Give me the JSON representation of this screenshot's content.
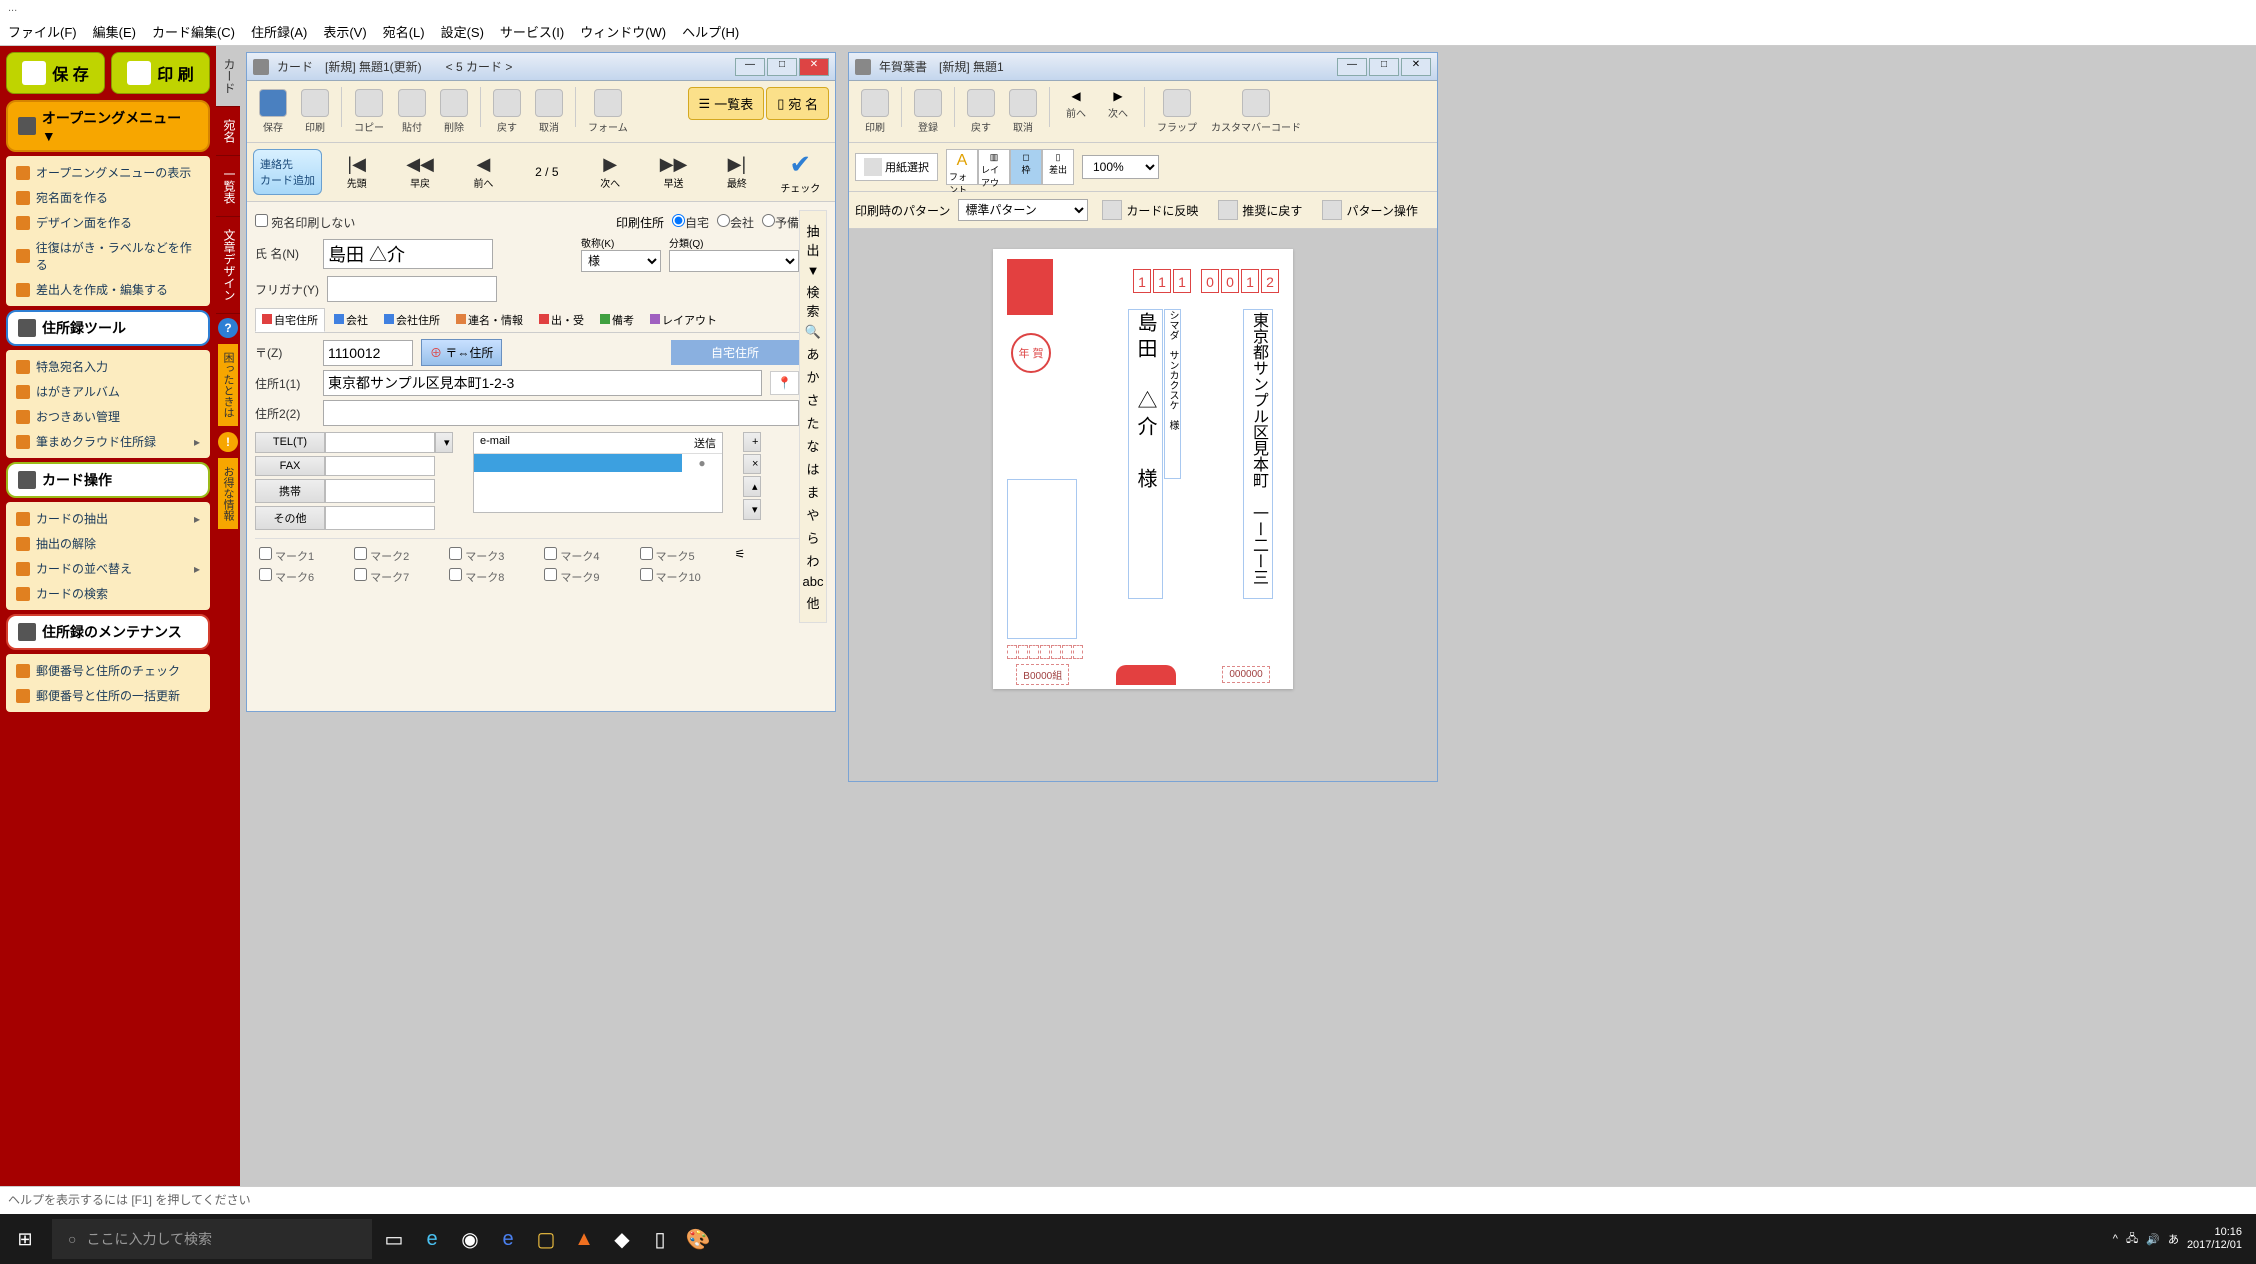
{
  "app_title": "...",
  "menubar": [
    "ファイル(F)",
    "編集(E)",
    "カード編集(C)",
    "住所録(A)",
    "表示(V)",
    "宛名(L)",
    "設定(S)",
    "サービス(I)",
    "ウィンドウ(W)",
    "ヘルプ(H)"
  ],
  "leftbar": {
    "save": "保 存",
    "print": "印 刷",
    "opening_hdr": "オープニングメニュー ▼",
    "opening_items": [
      "オープニングメニューの表示",
      "宛名面を作る",
      "デザイン面を作る",
      "往復はがき・ラベルなどを作る",
      "差出人を作成・編集する"
    ],
    "tool_hdr": "住所録ツール",
    "tool_items": [
      "特急宛名入力",
      "はがきアルバム",
      "おつきあい管理",
      "筆まめクラウド住所録"
    ],
    "card_hdr": "カード操作",
    "card_items": [
      "カードの抽出",
      "抽出の解除",
      "カードの並べ替え",
      "カードの検索"
    ],
    "maint_hdr": "住所録のメンテナンス",
    "maint_items": [
      "郵便番号と住所のチェック",
      "郵便番号と住所の一括更新"
    ],
    "vtabs": [
      "カード",
      "宛名",
      "一覧表",
      "文章デザイン"
    ],
    "help_vt": "困ったときは",
    "info_vt": "お得な情報"
  },
  "card_win": {
    "title": "カード　[新規]  無題1(更新)　　< 5 カード >",
    "tb": {
      "save": "保存",
      "print": "印刷",
      "copy": "コピー",
      "paste": "貼付",
      "delete": "削除",
      "undo": "戻す",
      "redo": "取消",
      "form": "フォーム",
      "list": "一覧表",
      "atena": "宛 名"
    },
    "nav": {
      "add": "連絡先\nカード追加",
      "first": "先頭",
      "fastback": "早戻",
      "prev": "前へ",
      "pos": "2 /",
      "total": "5",
      "next": "次へ",
      "fastfwd": "早送",
      "last": "最終",
      "check": "チェック"
    },
    "dont_print": "宛名印刷しない",
    "print_addr_lbl": "印刷住所",
    "radios": [
      "自宅",
      "会社",
      "予備"
    ],
    "name_lbl": "氏 名(N)",
    "name_val": "島田 △介",
    "furi_lbl": "フリガナ(Y)",
    "furi_val": "",
    "keisho_lbl": "敬称(K)",
    "keisho_val": "様",
    "bunrui_lbl": "分類(Q)",
    "addr_tabs": [
      "自宅住所",
      "会社",
      "会社住所",
      "連名・情報",
      "出・受",
      "備考",
      "レイアウト"
    ],
    "zip_lbl": "〒(Z)",
    "zip_val": "1110012",
    "zip_btn": "〒⇔住所",
    "home_btn": "自宅住所",
    "addr1_lbl": "住所1(1)",
    "addr1_val": "東京都サンプル区見本町1-2-3",
    "addr2_lbl": "住所2(2)",
    "addr2_val": "",
    "tel_lbl": "TEL(T)",
    "fax_lbl": "FAX",
    "mobile_lbl": "携帯",
    "other_lbl": "その他",
    "email_hdr": "e-mail",
    "email_send": "送信",
    "marks": [
      "マーク1",
      "マーク2",
      "マーク3",
      "マーク4",
      "マーク5",
      "マーク6",
      "マーク7",
      "マーク8",
      "マーク9",
      "マーク10"
    ],
    "side_index": [
      "抽出",
      "▼",
      "検索",
      "🔍",
      "あ",
      "か",
      "さ",
      "た",
      "な",
      "は",
      "ま",
      "や",
      "ら",
      "わ",
      "abc",
      "他"
    ]
  },
  "preview_win": {
    "title": "年賀葉書　[新規]  無題1",
    "tb": {
      "print": "印刷",
      "register": "登録",
      "undo": "戻す",
      "redo": "取消",
      "prev": "前へ",
      "next": "次へ",
      "flap": "フラップ",
      "barcode": "カスタマバーコード"
    },
    "tb2": {
      "paper": "用紙選択",
      "font": "フォント",
      "layout": "レイアウト",
      "frame": "枠",
      "output": "差出"
    },
    "zoom": "100%",
    "pattern_lbl": "印刷時のパターン",
    "pattern_val": "標準パターン",
    "reflect": "カードに反映",
    "reset": "推奨に戻す",
    "pattern_ops": "パターン操作",
    "postcard": {
      "zip": [
        "1",
        "1",
        "1",
        "0",
        "0",
        "1",
        "2"
      ],
      "nenga": "年 賀",
      "addr": "東京都サンプル区見本町 一ー二ー三",
      "name": "島田　△介　様",
      "furigana": "シマダ　サンカクスケ　様",
      "footer_l": "B0000組",
      "footer_r": "000000"
    }
  },
  "statusbar": "ヘルプを表示するには [F1] を押してください",
  "taskbar": {
    "search_placeholder": "ここに入力して検索",
    "time": "10:16",
    "date": "2017/12/01",
    "ime": "あ"
  }
}
